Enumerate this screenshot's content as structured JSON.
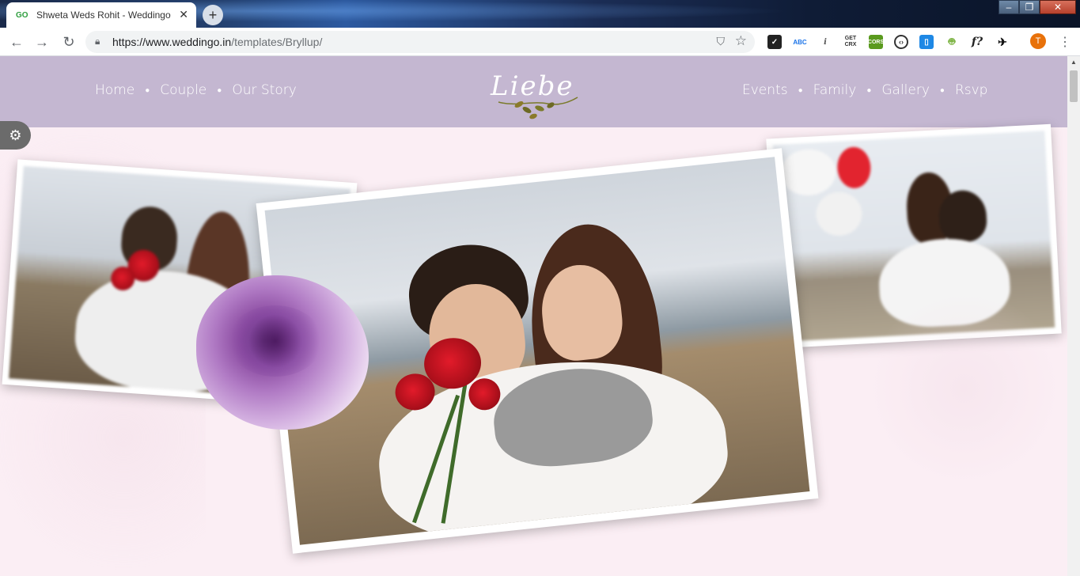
{
  "browser": {
    "tab_title": "Shweta Weds Rohit - Weddingo",
    "favicon_text": "GO",
    "url_host": "https://www.weddingo.in",
    "url_path": "/templates/Bryllup/",
    "avatar_letter": "T",
    "extensions": [
      "checkmark-ext",
      "abc-ext",
      "info-ext",
      "get-crx-ext",
      "cors-ext",
      "code-ext",
      "tablet-ext",
      "android-ext",
      "f-ext",
      "bird-ext"
    ]
  },
  "site": {
    "logo_text": "Liebe",
    "nav_left": [
      "Home",
      "Couple",
      "Our Story"
    ],
    "nav_right": [
      "Events",
      "Family",
      "Gallery",
      "Rsvp"
    ]
  },
  "colors": {
    "header_bg": "#c4b7d1",
    "page_bg": "#fbeef4",
    "settings_bg": "#6b6b6b",
    "accent_rose": "#c8101c"
  }
}
